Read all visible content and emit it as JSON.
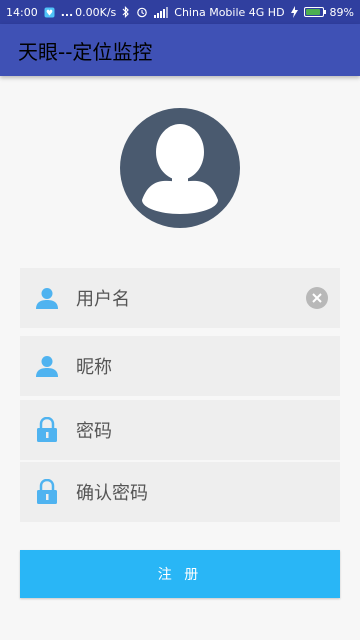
{
  "status_bar": {
    "time": "14:00",
    "dots": "...",
    "net_speed": "0.00K/s",
    "carrier": "China Mobile 4G HD",
    "battery_percent": "89%",
    "battery_level": 0.89,
    "icons": [
      "notification-icon",
      "bluetooth-icon",
      "alarm-icon",
      "signal-icon",
      "charging-icon",
      "battery-icon"
    ]
  },
  "app_bar": {
    "title": "天眼--定位监控"
  },
  "avatar": {
    "icon": "person-silhouette-icon"
  },
  "form": {
    "fields": [
      {
        "icon": "person-icon",
        "placeholder": "用户名",
        "has_clear": true,
        "clear_icon": "clear-icon"
      },
      {
        "icon": "person-icon",
        "placeholder": "昵称"
      },
      {
        "icon": "lock-icon",
        "placeholder": "密码"
      },
      {
        "icon": "lock-icon",
        "placeholder": "确认密码"
      }
    ],
    "register_label": "注 册"
  },
  "colors": {
    "status_bar": "#303f9f",
    "app_bar": "#3f51b5",
    "accent": "#29b6f6",
    "field_bg": "#eeeeee",
    "icon_blue": "#4fb3f0"
  }
}
